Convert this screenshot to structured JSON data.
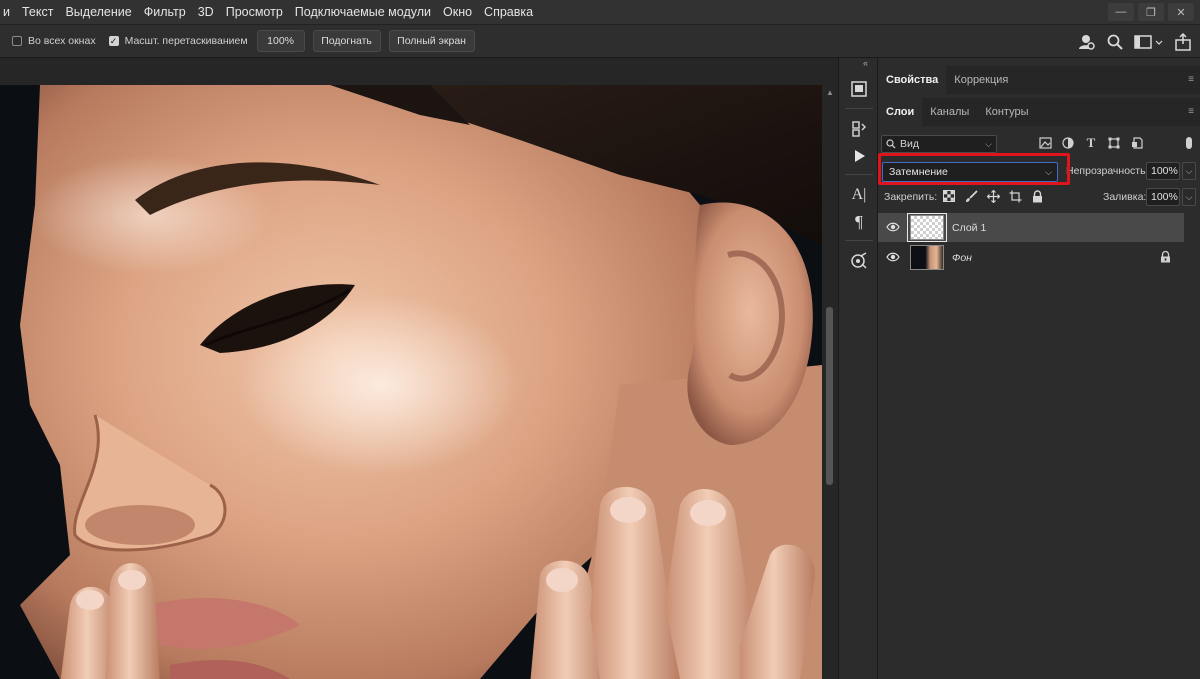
{
  "menu": [
    "и",
    "Текст",
    "Выделение",
    "Фильтр",
    "3D",
    "Просмотр",
    "Подключаемые модули",
    "Окно",
    "Справка"
  ],
  "options": {
    "all_windows_label": "Во всех окнах",
    "all_windows_checked": false,
    "scrubby_zoom_label": "Масшт. перетаскиванием",
    "scrubby_zoom_checked": true,
    "zoom_value": "100%",
    "fit_label": "Подогнать",
    "full_screen_label": "Полный экран"
  },
  "panel_tabs_top": {
    "properties": "Свойства",
    "adjustments": "Коррекция"
  },
  "panel_tabs_layers": {
    "layers": "Слои",
    "channels": "Каналы",
    "paths": "Контуры"
  },
  "layers_panel": {
    "filter_placeholder": "Вид",
    "blend_mode": "Затемнение",
    "opacity_label": "Непрозрачность:",
    "opacity_value": "100%",
    "lock_label": "Закрепить:",
    "fill_label": "Заливка:",
    "fill_value": "100%",
    "layers": [
      {
        "name": "Слой 1",
        "visible": true,
        "selected": true,
        "thumbnail": "transparent"
      },
      {
        "name": "Фон",
        "visible": true,
        "selected": false,
        "thumbnail": "photo",
        "locked": true
      }
    ]
  },
  "accent_colors": {
    "highlight": "#e0141b",
    "focus_border": "#3f6dc9"
  },
  "icons": [
    "minimize-icon",
    "restore-icon",
    "close-icon",
    "user-search-icon",
    "search-icon",
    "workspace-icon",
    "share-icon",
    "eye-icon",
    "lock-icon",
    "play-icon",
    "paragraph-icon",
    "character-icon"
  ]
}
